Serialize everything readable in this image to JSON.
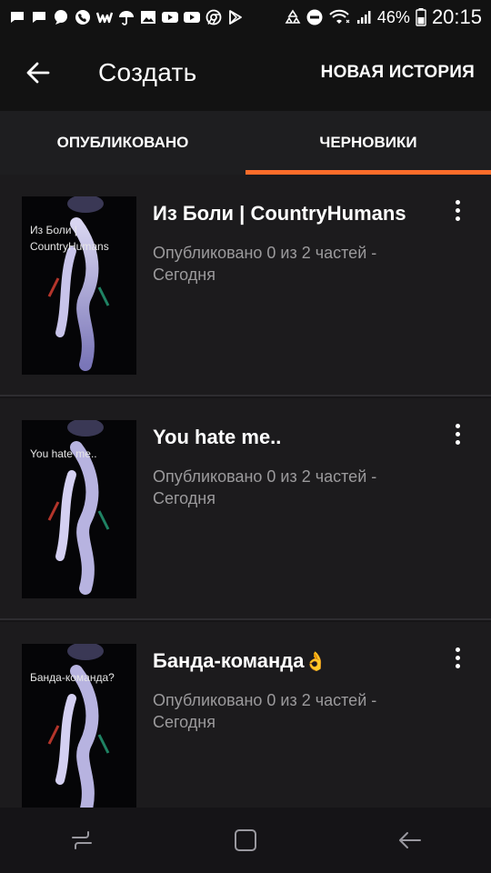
{
  "status_bar": {
    "battery": "46%",
    "time": "20:15",
    "left_icons": [
      "chat-icon",
      "chat-icon",
      "message-icon",
      "phone-icon",
      "wattpad-icon",
      "umbrella-icon",
      "gallery-icon",
      "youtube-icon",
      "youtube-icon",
      "chrome-icon",
      "play-store-icon"
    ],
    "right_icons": [
      "recycle-icon",
      "do-not-disturb-icon",
      "wifi-icon",
      "signal-icon"
    ]
  },
  "app_bar": {
    "title": "Создать",
    "new_story": "НОВАЯ ИСТОРИЯ"
  },
  "tabs": [
    {
      "label": "ОПУБЛИКОВАНО",
      "active": false
    },
    {
      "label": "ЧЕРНОВИКИ",
      "active": true
    }
  ],
  "accent_color": "#ff6d2a",
  "stories": [
    {
      "title": "Из Боли | CountryHumans",
      "cover_text": "Из Боли | CountryHumans",
      "meta": "Опубликовано 0 из 2 частей - Сегодня"
    },
    {
      "title": "You hate me..",
      "cover_text": "You hate me..",
      "meta": "Опубликовано 0 из 2 частей - Сегодня"
    },
    {
      "title": "Банда-команда",
      "title_emoji": "👌",
      "cover_text": "Банда-команда?",
      "meta": "Опубликовано 0 из 2 частей - Сегодня"
    }
  ],
  "nav_bar": [
    "recent-apps-icon",
    "home-icon",
    "back-icon"
  ]
}
